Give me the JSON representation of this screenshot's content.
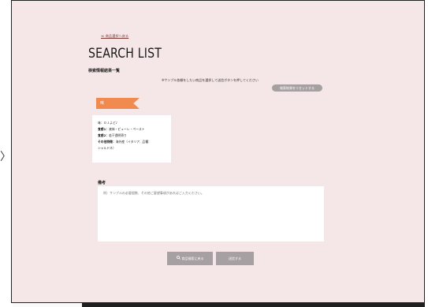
{
  "nav": {
    "left_arrow": "〉",
    "back_link": "≪ 商品選択へ戻る"
  },
  "header": {
    "title": "SEARCH LIST",
    "subtitle": "検索情報結果一覧",
    "instruction": "※サンプル依頼をしたい商品を選択して送信ボタンを押してください",
    "reset_button": "検索結果をリセットする"
  },
  "product": {
    "tag": "味",
    "lines": [
      {
        "label": "",
        "value": "味：ＤＪよど♪"
      },
      {
        "label": "食感1：",
        "value": "液体・ピューレ・ペースト"
      },
      {
        "label": "食感2：",
        "value": "若干透明寄り"
      },
      {
        "label": "その他特徴：",
        "value": "海外産（イタリア、品種："
      },
      {
        "label": "",
        "value": "シャルドネ）"
      }
    ]
  },
  "notes": {
    "label": "備考",
    "placeholder": "例）サンプルの必要個数、その他ご要望事項があればご入力ください。"
  },
  "actions": {
    "search_back_icon": "search-icon",
    "search_back_label": "商品検索に戻る",
    "send_label": "送信する"
  },
  "colors": {
    "background": "#f5e6e8",
    "accent_tag": "#f08a4e",
    "button_gray": "#a6a0a2"
  }
}
